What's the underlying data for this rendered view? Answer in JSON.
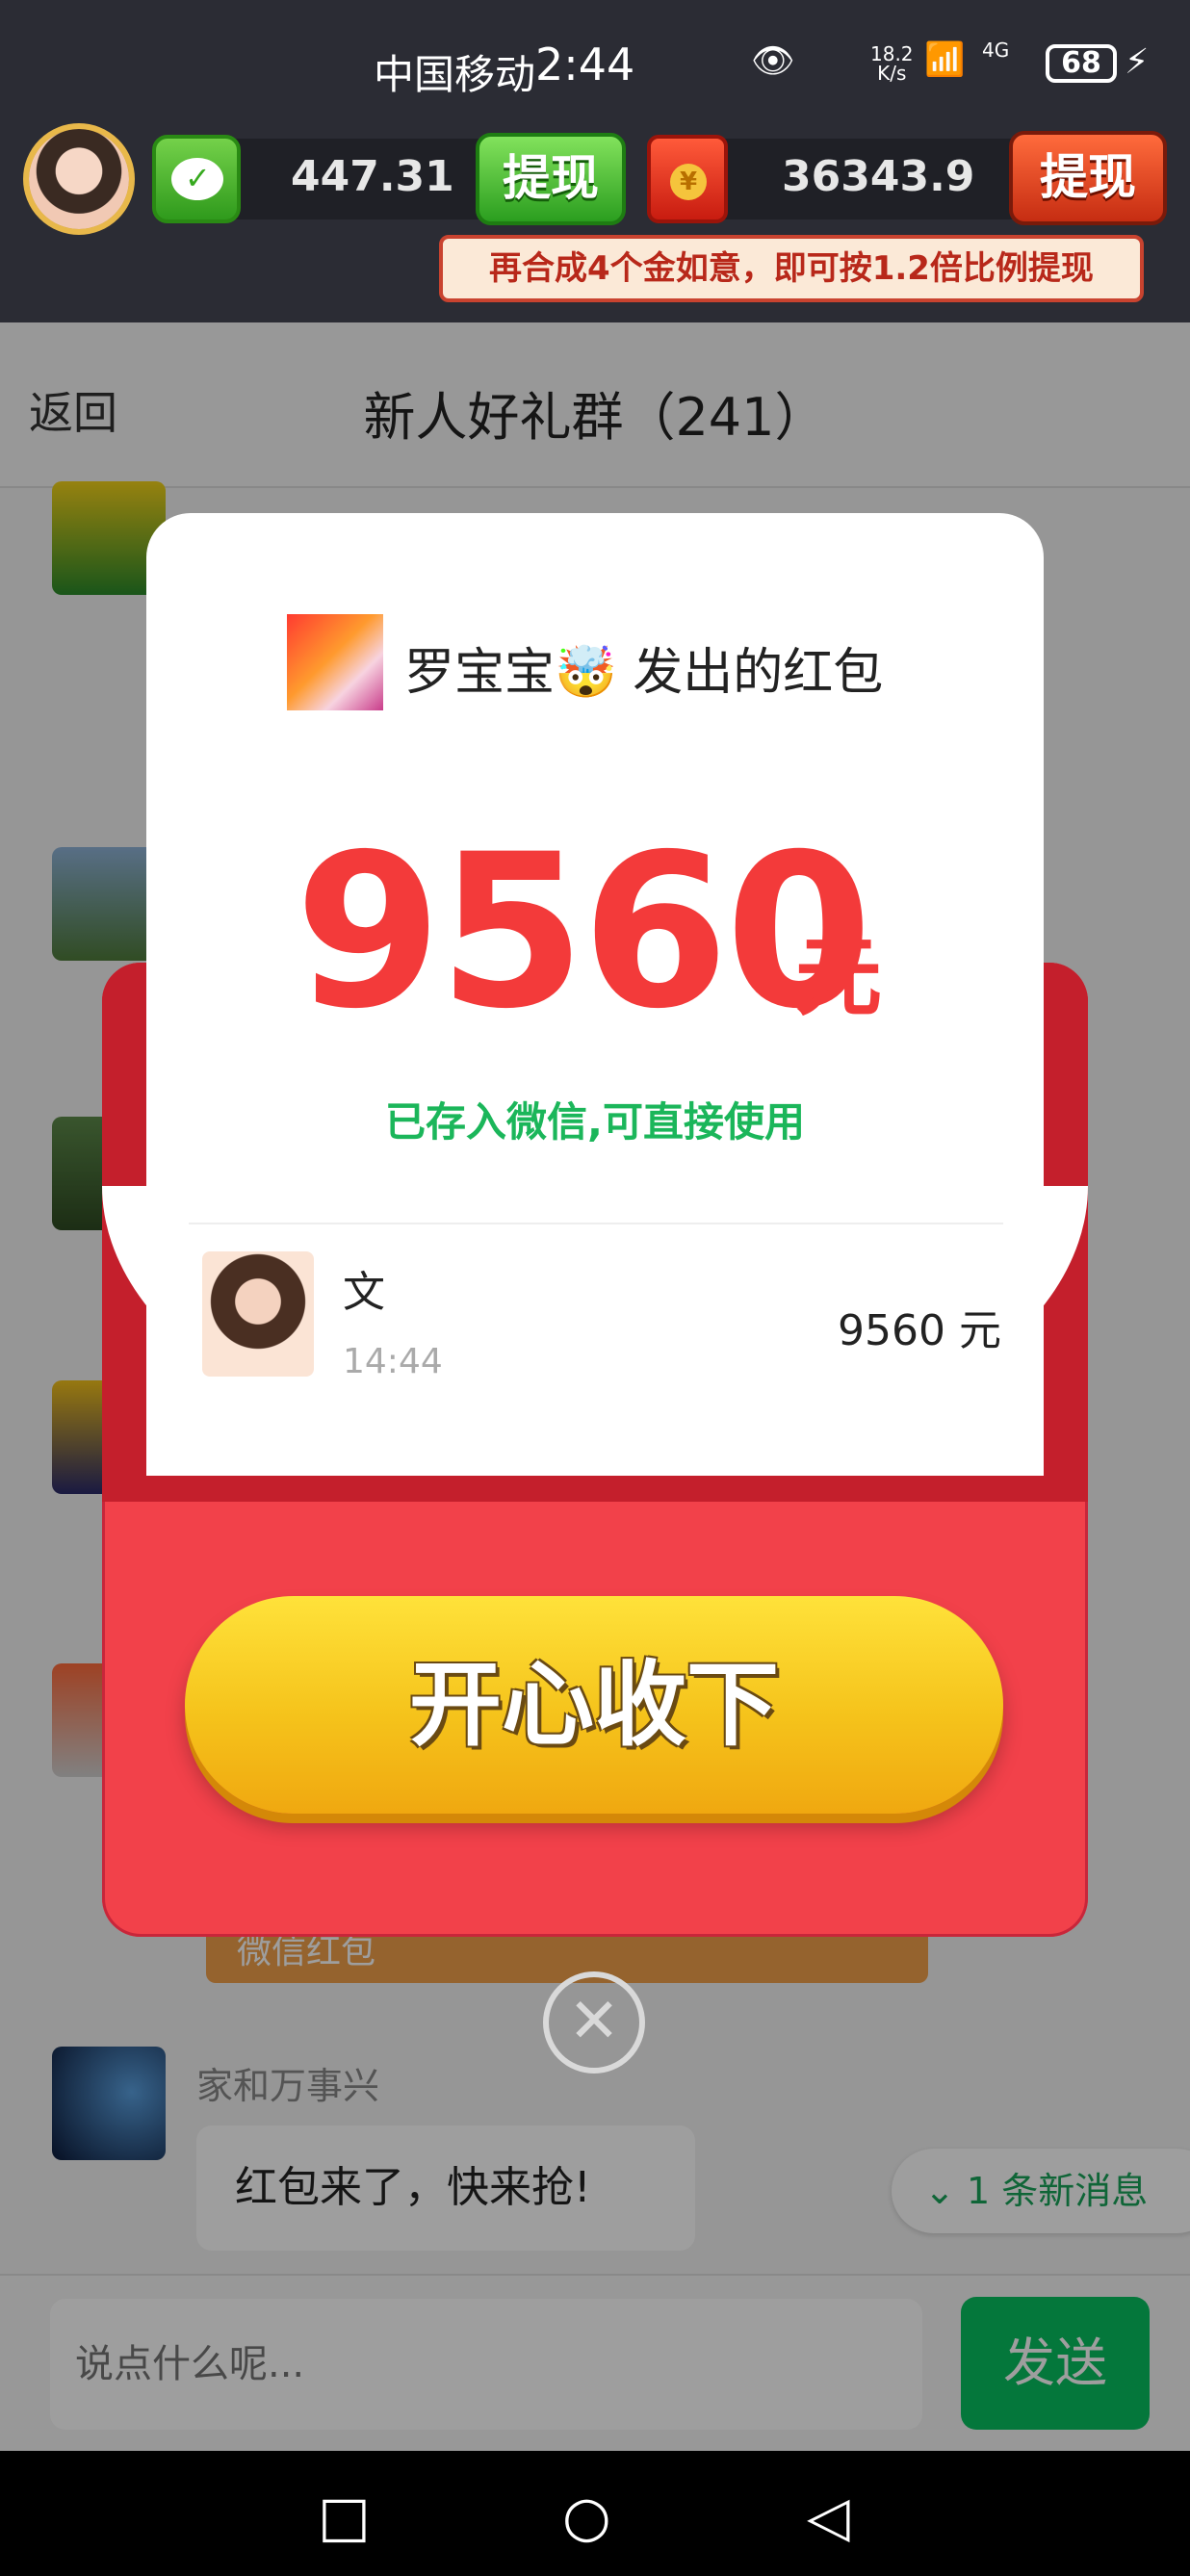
{
  "status_bar": {
    "carrier": "中国移动",
    "time": "2:44",
    "speed_value": "18.2",
    "speed_unit": "K/s",
    "network": "4G",
    "battery": "68"
  },
  "game_header": {
    "wechat_balance": "447.31",
    "withdraw_label": "提现",
    "redpacket_balance": "36343.9",
    "withdraw_label_2": "提现",
    "tip": "再合成4个金如意，即可按1.2倍比例提现"
  },
  "chat": {
    "back_label": "返回",
    "group_title": "新人好礼群（241）",
    "redpacket_tag": "微信红包",
    "last_sender": "家和万事兴",
    "last_message": "红包来了，快来抢!",
    "new_message_hint": "1 条新消息",
    "input_placeholder": "说点什么呢...",
    "send_label": "发送"
  },
  "modal": {
    "from_text": "罗宝宝🤯 发出的红包",
    "amount": "9560",
    "amount_unit": "元",
    "saved_text": "已存入微信,可直接使用",
    "recipient_name": "文",
    "recipient_time": "14:44",
    "recipient_amount": "9560 元",
    "accept_label": "开心收下",
    "close_glyph": "✕"
  },
  "colors": {
    "accent_red": "#f33a3a",
    "wechat_green": "#07c160",
    "gold": "#f5c31b"
  }
}
